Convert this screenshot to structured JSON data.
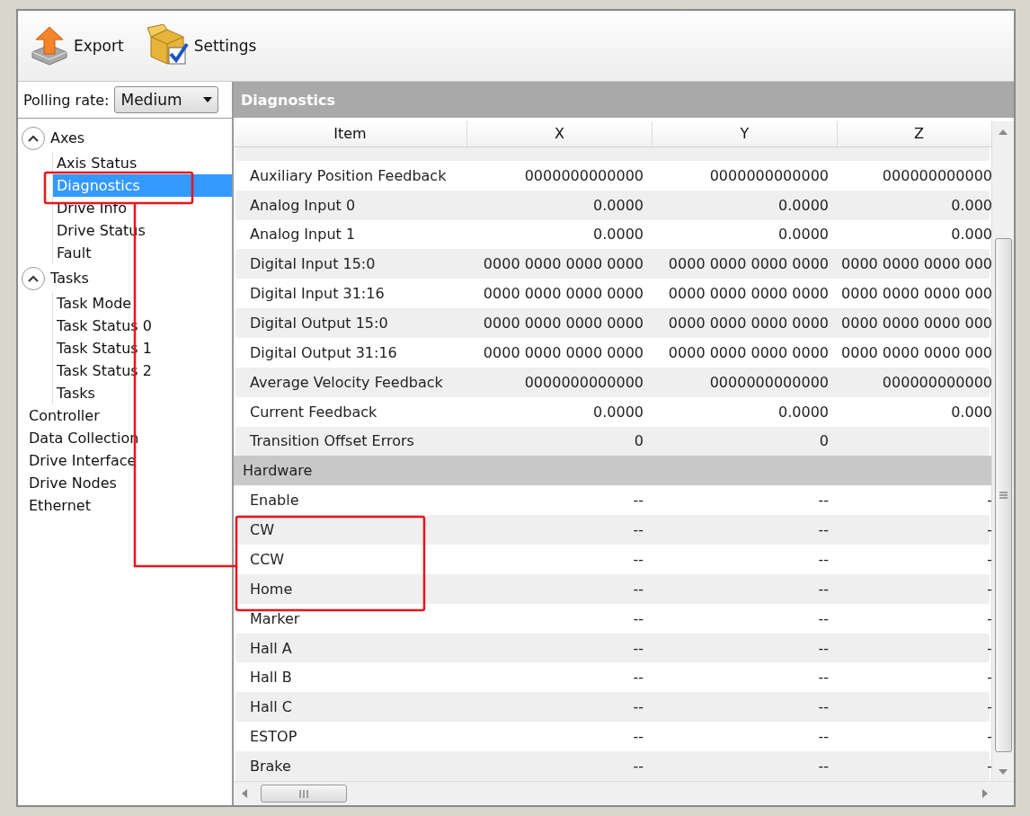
{
  "toolbar": [
    {
      "kind": "export",
      "label": "Export"
    },
    {
      "kind": "settings",
      "label": "Settings"
    }
  ],
  "polling": {
    "label": "Polling rate:",
    "value": "Medium"
  },
  "tree": [
    {
      "label": "Axes",
      "expanded": true,
      "selected": false,
      "children": [
        {
          "label": "Axis Status",
          "selected": false
        },
        {
          "label": "Diagnostics",
          "selected": true
        },
        {
          "label": "Drive Info",
          "selected": false
        },
        {
          "label": "Drive Status",
          "selected": false
        },
        {
          "label": "Fault",
          "selected": false
        }
      ]
    },
    {
      "label": "Tasks",
      "expanded": true,
      "selected": false,
      "children": [
        {
          "label": "Task Mode",
          "selected": false
        },
        {
          "label": "Task Status 0",
          "selected": false
        },
        {
          "label": "Task Status 1",
          "selected": false
        },
        {
          "label": "Task Status 2",
          "selected": false
        },
        {
          "label": "Tasks",
          "selected": false
        }
      ]
    },
    {
      "label": "Controller",
      "selected": false
    },
    {
      "label": "Data Collection",
      "selected": false
    },
    {
      "label": "Drive Interface",
      "selected": false
    },
    {
      "label": "Drive Nodes",
      "selected": false
    },
    {
      "label": "Ethernet",
      "selected": false
    }
  ],
  "panel_title": "Diagnostics",
  "table": {
    "columns": [
      "Item",
      "X",
      "Y",
      "Z"
    ],
    "rows": [
      {
        "kind": "cut"
      },
      {
        "kind": "data",
        "cells": [
          "Auxiliary Position Feedback",
          "0000000000000",
          "0000000000000",
          "000000000000"
        ]
      },
      {
        "kind": "data",
        "cells": [
          "Analog Input 0",
          "0.0000",
          "0.0000",
          "0.000"
        ]
      },
      {
        "kind": "data",
        "cells": [
          "Analog Input 1",
          "0.0000",
          "0.0000",
          "0.000"
        ]
      },
      {
        "kind": "data",
        "cells": [
          "Digital Input 15:0",
          "0000 0000 0000 0000",
          "0000 0000 0000 0000",
          "0000 0000 0000 000"
        ]
      },
      {
        "kind": "data",
        "cells": [
          "Digital Input 31:16",
          "0000 0000 0000 0000",
          "0000 0000 0000 0000",
          "0000 0000 0000 000"
        ]
      },
      {
        "kind": "data",
        "cells": [
          "Digital Output 15:0",
          "0000 0000 0000 0000",
          "0000 0000 0000 0000",
          "0000 0000 0000 000"
        ]
      },
      {
        "kind": "data",
        "cells": [
          "Digital Output 31:16",
          "0000 0000 0000 0000",
          "0000 0000 0000 0000",
          "0000 0000 0000 000"
        ]
      },
      {
        "kind": "data",
        "cells": [
          "Average Velocity Feedback",
          "0000000000000",
          "0000000000000",
          "000000000000"
        ]
      },
      {
        "kind": "data",
        "cells": [
          "Current Feedback",
          "0.0000",
          "0.0000",
          "0.000"
        ]
      },
      {
        "kind": "data",
        "cells": [
          "Transition Offset Errors",
          "0",
          "0",
          ""
        ]
      },
      {
        "kind": "group",
        "label": "Hardware"
      },
      {
        "kind": "data",
        "cells": [
          "Enable",
          "--",
          "--",
          "-"
        ]
      },
      {
        "kind": "data",
        "cells": [
          "CW",
          "--",
          "--",
          "-"
        ]
      },
      {
        "kind": "data",
        "cells": [
          "CCW",
          "--",
          "--",
          "-"
        ]
      },
      {
        "kind": "data",
        "cells": [
          "Home",
          "--",
          "--",
          "-"
        ]
      },
      {
        "kind": "data",
        "cells": [
          "Marker",
          "--",
          "--",
          "-"
        ]
      },
      {
        "kind": "data",
        "cells": [
          "Hall A",
          "--",
          "--",
          "-"
        ]
      },
      {
        "kind": "data",
        "cells": [
          "Hall B",
          "--",
          "--",
          "-"
        ]
      },
      {
        "kind": "data",
        "cells": [
          "Hall C",
          "--",
          "--",
          "-"
        ]
      },
      {
        "kind": "data",
        "cells": [
          "ESTOP",
          "--",
          "--",
          "-"
        ]
      },
      {
        "kind": "data",
        "cells": [
          "Brake",
          "--",
          "--",
          "-"
        ]
      }
    ]
  }
}
